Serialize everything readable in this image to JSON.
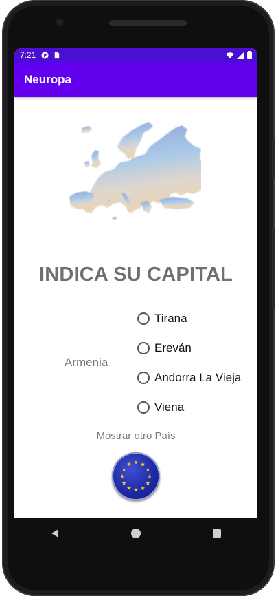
{
  "status_bar": {
    "time": "7:21",
    "icons": [
      "p-icon",
      "sd-card-icon",
      "wifi-icon",
      "signal-icon",
      "battery-icon"
    ]
  },
  "app_bar": {
    "title": "Neuropa"
  },
  "main": {
    "heading": "INDICA SU CAPITAL",
    "country": "Armenia",
    "options": [
      {
        "label": "Tirana",
        "selected": false
      },
      {
        "label": "Ereván",
        "selected": false
      },
      {
        "label": "Andorra La Vieja",
        "selected": false
      },
      {
        "label": "Viena",
        "selected": false
      }
    ],
    "show_other_label": "Mostrar otro País",
    "flag_icon": "eu-flag-icon"
  },
  "colors": {
    "status_bar": "#4a0fd1",
    "app_bar": "#6200ee",
    "heading": "#707070"
  },
  "nav_bar": {
    "icons": [
      "back-icon",
      "home-icon",
      "recents-icon"
    ]
  }
}
